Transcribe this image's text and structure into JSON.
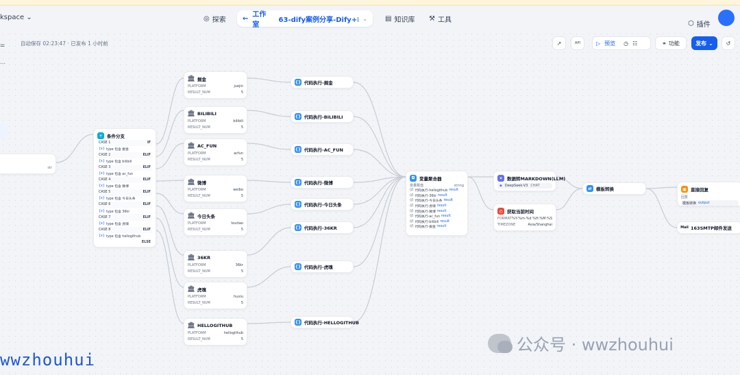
{
  "topbar": {
    "workspace": "kspace",
    "explore": "探索",
    "studio": "工作室",
    "app_name": "63-dify案例分享-Dify+R...",
    "knowledge": "知识库",
    "tools": "工具",
    "plugins": "插件"
  },
  "toolbar": {
    "autosave": "自动保存 02:23:47 · 已发布 1 小时前",
    "preview": "预览",
    "features": "功能",
    "publish": "发布"
  },
  "colors": {
    "accent": "#155eef",
    "edge": "#c8ccd4"
  },
  "start_node": {
    "value": "str"
  },
  "condition_node": {
    "title": "条件分支",
    "cases": [
      {
        "label": "CASE 1",
        "kw": "IF",
        "cond": "type 包含 掘金"
      },
      {
        "label": "CASE 2",
        "kw": "ELIF",
        "cond": "type 包含 bilibili"
      },
      {
        "label": "CASE 3",
        "kw": "ELIF",
        "cond": "type 包含 ac_fun"
      },
      {
        "label": "CASE 4",
        "kw": "ELIF",
        "cond": "type 包含 微博"
      },
      {
        "label": "CASE 5",
        "kw": "ELIF",
        "cond": "type 包含 今日头条"
      },
      {
        "label": "CASE 6",
        "kw": "ELIF",
        "cond": "type 包含 36kr"
      },
      {
        "label": "CASE 7",
        "kw": "ELIF",
        "cond": "type 包含 虎嗅"
      },
      {
        "label": "CASE 8",
        "kw": "ELIF",
        "cond": "type 包含 hellogithub"
      }
    ],
    "else": "ELSE"
  },
  "tool_nodes": [
    {
      "title": "掘金",
      "platform": "juejin",
      "num": "5"
    },
    {
      "title": "BILIBILI",
      "platform": "bilibili",
      "num": "5"
    },
    {
      "title": "AC_FUN",
      "platform": "acfun",
      "num": "5"
    },
    {
      "title": "微博",
      "platform": "weibo",
      "num": "5"
    },
    {
      "title": "今日头条",
      "platform": "toutiao",
      "num": "5"
    },
    {
      "title": "36KR",
      "platform": "36kr",
      "num": "5"
    },
    {
      "title": "虎嗅",
      "platform": "huxiu",
      "num": "5"
    },
    {
      "title": "HELLOGITHUB",
      "platform": "hellogithub",
      "num": "5"
    }
  ],
  "tool_labels": {
    "platform": "PLATFORM",
    "result_num": "RESULT_NUM"
  },
  "code_nodes": [
    {
      "title": "代码执行-掘金"
    },
    {
      "title": "代码执行-BILIBILI"
    },
    {
      "title": "代码执行-AC_FUN"
    },
    {
      "title": "代码执行-微博"
    },
    {
      "title": "代码执行-今日头条"
    },
    {
      "title": "代码执行-36KR"
    },
    {
      "title": "代码执行-虎嗅"
    },
    {
      "title": "代码执行-HELLOGITHUB"
    }
  ],
  "aggregator": {
    "title": "变量聚合器",
    "group": "变量赋值",
    "type": "string",
    "items": [
      {
        "src": "代码执行-hellogithub",
        "var": "result"
      },
      {
        "src": "代码执行-36kr",
        "var": "result"
      },
      {
        "src": "代码执行-今日头条",
        "var": "result"
      },
      {
        "src": "代码执行-虎嗅",
        "var": "result"
      },
      {
        "src": "代码执行-微博",
        "var": "result"
      },
      {
        "src": "代码执行-ac_fun",
        "var": "result"
      },
      {
        "src": "代码执行-bilibili",
        "var": "result"
      },
      {
        "src": "代码执行-掘金",
        "var": "result"
      }
    ]
  },
  "llm_node": {
    "title": "数据转MARKDOWN(LLM)",
    "model": "DeepSeek-V3",
    "tag": "CHAT"
  },
  "time_node": {
    "title": "获取当前时间",
    "format_label": "FORMAT",
    "format": "%Y-%m-%d %H:%M:%S",
    "tz_label": "TIMEZONE",
    "tz": "Asia/Shanghai"
  },
  "template_node": {
    "title": "模板转换"
  },
  "answer_node": {
    "title": "直接回复",
    "label": "回复",
    "value": "模板转换",
    "var": "output"
  },
  "smtp_node": {
    "title": "163SMTP邮件发送"
  },
  "watermark": "wwzhouhui",
  "wechat": "公众号 · wwzhouhui"
}
